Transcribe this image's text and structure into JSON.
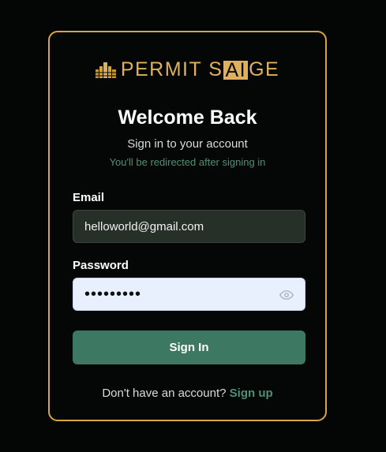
{
  "brand": {
    "logo_pre": "PERMIT S",
    "logo_ai": "AI",
    "logo_post": "GE",
    "accent_color": "#d9a63c",
    "logo_icon": "building-bars-icon"
  },
  "form": {
    "title": "Welcome Back",
    "subtitle": "Sign in to your account",
    "redirect_note": "You'll be redirected after signing in",
    "email_label": "Email",
    "email_value": "helloworld@gmail.com",
    "password_label": "Password",
    "password_value": "•••••••••",
    "password_toggle_icon": "eye-icon",
    "submit_label": "Sign In",
    "button_color": "#3c7862"
  },
  "footer": {
    "prompt": "Don't have an account?",
    "link": "Sign up",
    "link_color": "#4f8f76"
  }
}
